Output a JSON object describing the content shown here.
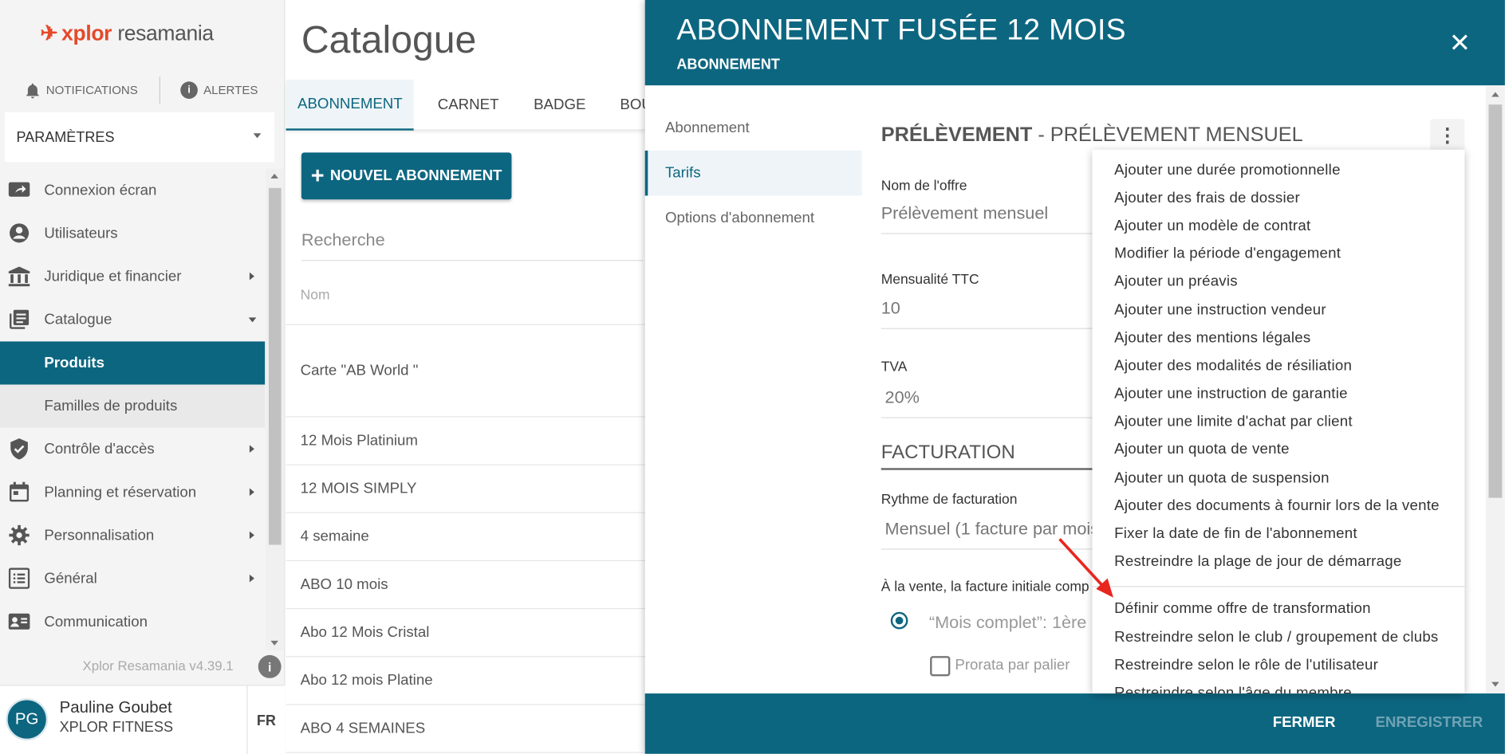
{
  "brand": {
    "logo_part1": "xplor",
    "logo_part2": "resamania",
    "accent": "#e5492a",
    "primary": "#0d6680"
  },
  "top_links": {
    "notifications": "NOTIFICATIONS",
    "alerts": "ALERTES"
  },
  "settings_select": {
    "value": "PARAMÈTRES"
  },
  "sidebar": {
    "items": [
      {
        "label": "Connexion écran",
        "icon": "screen-share-icon"
      },
      {
        "label": "Utilisateurs",
        "icon": "user-icon"
      },
      {
        "label": "Juridique et financier",
        "icon": "bank-icon"
      },
      {
        "label": "Catalogue",
        "icon": "catalog-icon"
      },
      {
        "label": "Produits"
      },
      {
        "label": "Familles de produits"
      },
      {
        "label": "Contrôle d'accès",
        "icon": "shield-check-icon"
      },
      {
        "label": "Planning et réservation",
        "icon": "calendar-icon"
      },
      {
        "label": "Personnalisation",
        "icon": "gear-icon"
      },
      {
        "label": "Général",
        "icon": "list-icon"
      },
      {
        "label": "Communication",
        "icon": "contact-card-icon"
      }
    ],
    "version": "Xplor Resamania v4.39.1"
  },
  "user": {
    "initials": "PG",
    "name": "Pauline Goubet",
    "org": "XPLOR FITNESS",
    "lang": "FR"
  },
  "catalogue": {
    "title": "Catalogue",
    "tabs": [
      "ABONNEMENT",
      "CARNET",
      "BADGE",
      "BOU"
    ],
    "new_button": "NOUVEL ABONNEMENT",
    "search_placeholder": "Recherche",
    "column_name": "Nom",
    "rows": [
      "Carte \"AB World \"",
      "12 Mois Platinium",
      "12 MOIS SIMPLY",
      "4 semaine",
      "ABO 10 mois",
      "Abo 12 Mois Cristal",
      "Abo 12 mois Platine",
      "ABO 4 SEMAINES"
    ]
  },
  "modal": {
    "title": "ABONNEMENT FUSÉE 12 MOIS",
    "subtitle": "ABONNEMENT",
    "nav": [
      "Abonnement",
      "Tarifs",
      "Options d'abonnement"
    ],
    "section_bold": "PRÉLÈVEMENT",
    "section_rest": " - PRÉLÈVEMENT MENSUEL",
    "fields": {
      "offer_label": "Nom de l'offre",
      "offer_value": "Prélèvement mensuel",
      "monthly_label": "Mensualité TTC",
      "monthly_value": "10",
      "vat_label": "TVA",
      "vat_value": "20%"
    },
    "billing_title": "FACTURATION",
    "rhythm_label": "Rythme de facturation",
    "rhythm_value": "Mensuel (1 facture par mois",
    "initial_invoice_label": "À la vente, la facture initiale comp",
    "radio_label": "“Mois complet”: 1ère",
    "checkbox_label": "Prorata par palier",
    "footer": {
      "close": "FERMER",
      "save": "ENREGISTRER"
    }
  },
  "menu": {
    "group1": [
      "Ajouter une durée promotionnelle",
      "Ajouter des frais de dossier",
      "Ajouter un modèle de contrat",
      "Modifier la période d'engagement",
      "Ajouter un préavis",
      "Ajouter une instruction vendeur",
      "Ajouter des mentions légales",
      "Ajouter des modalités de résiliation",
      "Ajouter une instruction de garantie",
      "Ajouter une limite d'achat par client",
      "Ajouter un quota de vente",
      "Ajouter un quota de suspension",
      "Ajouter des documents à fournir lors de la vente",
      "Fixer la date de fin de l'abonnement",
      "Restreindre la plage de jour de démarrage"
    ],
    "group2": [
      "Définir comme offre de transformation",
      "Restreindre selon le club / groupement de clubs",
      "Restreindre selon le rôle de l'utilisateur",
      "Restreindre selon l'âge du membre"
    ]
  }
}
